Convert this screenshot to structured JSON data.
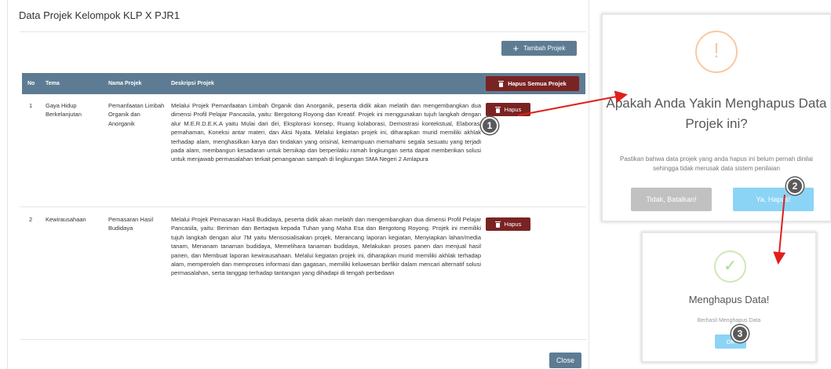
{
  "modal": {
    "title": "Data Projek Kelompok KLP X PJR1",
    "add_label": "Tambah Projek",
    "close_label": "Close"
  },
  "table": {
    "headers": {
      "no": "No",
      "tema": "Tema",
      "nama": "Nama Projek",
      "deskripsi": "Deskripsi Projek"
    },
    "delete_all_label": "Hapus Semua Projek",
    "rows": [
      {
        "no": "1",
        "tema": "Gaya Hidup Berkelanjutan",
        "nama": "Pemanfaatan Limbah Organik dan Anorganik",
        "deskripsi": "Melalui Projek Pemanfaatan Limbah Organik dan Anorganik, peserta didik akan melatih dan mengembangkan dua dimensi Profil Pelajar Pancasila, yaitu: Bergotong Royong dan Kreatif. Projek ini menggunakan tujuh langkah dengan alur M.E.R.D.E.K.A yaitu Mulai dari diri, Eksplorasi konsep, Ruang kolaborasi, Demostrasi kontekstual, Elaborasi pemahaman, Koneksi antar materi, dan Aksi Nyata. Melalui kegiatan projek ini, diharapkan murid memiliki akhlak terhadap alam, menghasilkan karya dan tindakan yang orisinal, kemampuan memahami segala sesuatu yang terjadi pada alam, membangun kesadaran untuk bersikap dan berperilaku ramah lingkungan serta dapat memberikan solusi untuk menjawab permasalahan terkait penanganan sampah di lingkungan SMA Negeri 2 Amlapura",
        "delete_label": "Hapus"
      },
      {
        "no": "2",
        "tema": "Kewirausahaan",
        "nama": "Pemasaran Hasil Budidaya",
        "deskripsi": "Melalui Projek Pemasaran Hasil Budidaya, peserta didik akan melatih dan mengembangkan dua dimensi Profil Pelajar Pancasila, yaitu: Beriman dan Bertaqwa kepada Tuhan yang Maha Esa dan Bergotong Royong. Projek ini memiliki tujuh langkah dengan alur 7M yaitu Mensosialisakan projek, Merancang laporan kegiatan, Menyiapkan lahan/media tanam, Menanam tanaman budidaya, Memelihara tanaman budidaya, Melakukan proses panen dan menjual hasil panen, dan Membuat laporan kewirausahaan. Melalui kegiatan projek ini, diharapkan murid memiliki akhlak terhadap alam, memperoleh dan memproses informasi dan gagasan, memiliki keluwesan berfikir dalam mencari alternatif solusi permasalahan, serta tanggap terhadap tantangan yang dihadapi di tengah perbedaan",
        "delete_label": "Hapus"
      }
    ]
  },
  "confirm_dialog": {
    "icon": "warning-icon",
    "title": "Apakah Anda Yakin Menghapus Data Projek ini?",
    "text": "Pastikan bahwa data projek yang anda hapus ini belum pernah dinilai sehingga tidak merusak data sistem penilaian",
    "cancel_label": "Tidak, Batalkan!",
    "confirm_label": "Ya, Hapus!"
  },
  "success_dialog": {
    "icon": "check-icon",
    "title": "Menghapus Data!",
    "text": "Berhasil Menghapus Data",
    "ok_label": "OK"
  },
  "markers": [
    "1",
    "2",
    "3"
  ],
  "colors": {
    "header": "#5d7c93",
    "danger": "#7a2323",
    "confirm": "#8cd4f5",
    "cancel": "#c1c1c1",
    "arrow": "#e0201d"
  }
}
